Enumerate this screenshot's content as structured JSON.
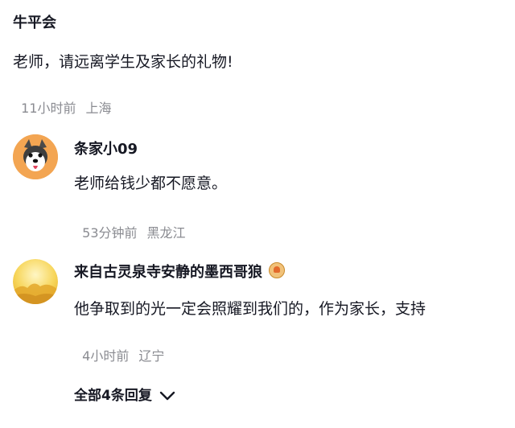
{
  "main_comment": {
    "username": "牛平会",
    "text": "老师，请远离学生及家长的礼物!",
    "time": "11小时前",
    "location": "上海"
  },
  "replies": [
    {
      "username": "条家小09",
      "text": "老师给钱少都不愿意。",
      "time": "53分钟前",
      "location": "黑龙江",
      "avatar_icon": "husky-dog-avatar-icon"
    },
    {
      "username": "来自古灵泉寺安静的墨西哥狼",
      "text": "他争取到的光一定会照耀到我们的，作为家长，支持",
      "time": "4小时前",
      "location": "辽宁",
      "avatar_icon": "yellow-landscape-avatar-icon",
      "badge_icon": "medal-badge-icon"
    }
  ],
  "expand_replies": {
    "label": "全部4条回复",
    "icon": "chevron-down-icon"
  },
  "colors": {
    "text": "#161823",
    "meta": "#8a8b91"
  }
}
